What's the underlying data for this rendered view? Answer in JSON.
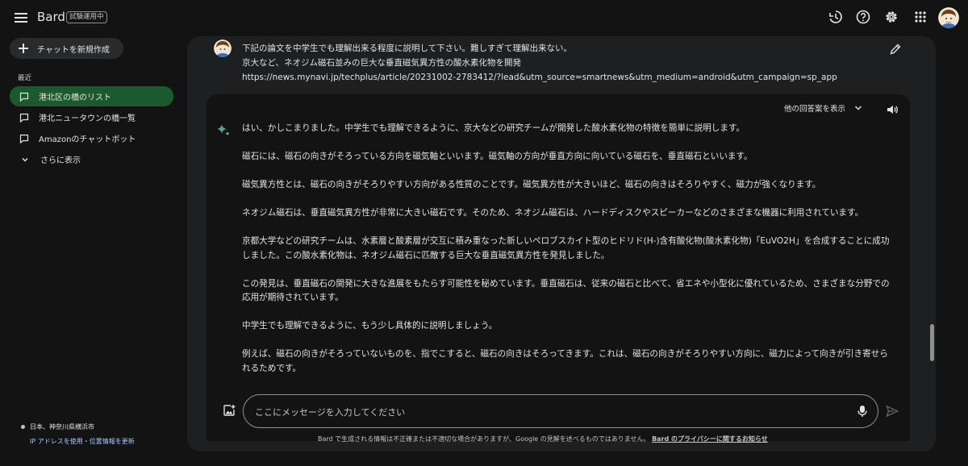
{
  "header": {
    "brand": "Bard",
    "badge": "試験運用中",
    "icons": [
      "menu-icon",
      "history-icon",
      "help-icon",
      "settings-icon",
      "apps-icon",
      "account-avatar"
    ]
  },
  "sidebar": {
    "new_chat_label": "チャットを新規作成",
    "recent_label": "最近",
    "items": [
      {
        "label": "港北区の橋のリスト",
        "active": true
      },
      {
        "label": "港北ニュータウンの橋一覧",
        "active": false
      },
      {
        "label": "Amazonのチャットボット",
        "active": false
      }
    ],
    "more_label": "さらに表示",
    "location": "日本、神奈川県横浜市",
    "location_link": "IP アドレスを使用・位置情報を更新"
  },
  "prompt": {
    "lines": [
      "下記の論文を中学生でも理解出来る程度に説明して下さい。難しすぎて理解出来ない。",
      "京大など、ネオジム磁石並みの巨大な垂直磁気異方性の酸水素化物を開発",
      "https://news.mynavi.jp/techplus/article/20231002-2783412/?lead&utm_source=smartnews&utm_medium=android&utm_campaign=sp_app"
    ]
  },
  "answer": {
    "alt_drafts_label": "他の回答案を表示",
    "paragraphs": [
      "はい、かしこまりました。中学生でも理解できるように、京大などの研究チームが開発した酸水素化物の特徴を簡単に説明します。",
      "磁石には、磁石の向きがそろっている方向を磁気軸といいます。磁気軸の方向が垂直方向に向いている磁石を、垂直磁石といいます。",
      "磁気異方性とは、磁石の向きがそろりやすい方向がある性質のことです。磁気異方性が大きいほど、磁石の向きはそろりやすく、磁力が強くなります。",
      "ネオジム磁石は、垂直磁気異方性が非常に大きい磁石です。そのため、ネオジム磁石は、ハードディスクやスピーカーなどのさまざまな機器に利用されています。",
      "京都大学などの研究チームは、水素層と酸素層が交互に積み重なった新しいペロブスカイト型のヒドリド(H-)含有酸化物(酸水素化物)「EuVO2H」を合成することに成功しました。この酸水素化物は、ネオジム磁石に匹敵する巨大な垂直磁気異方性を発見しました。",
      "この発見は、垂直磁石の開発に大きな進展をもたらす可能性を秘めています。垂直磁石は、従来の磁石と比べて、省エネや小型化に優れているため、さまざまな分野での応用が期待されています。",
      "中学生でも理解できるように、もう少し具体的に説明しましょう。",
      "例えば、磁石の向きがそろっていないものを、指でこすると、磁石の向きはそろってきます。これは、磁石の向きがそろりやすい方向に、磁力によって向きが引き寄せられるためです。"
    ]
  },
  "input": {
    "placeholder": "ここにメッセージを入力してください"
  },
  "footer": {
    "text": "Bard で生成される情報は不正確または不適切な場合がありますが、Google の見解を述べるものではありません。",
    "link": "Bard のプライバシーに関するお知らせ"
  },
  "colors": {
    "background": "#131314",
    "panel": "#1e1f20",
    "active_item": "#1b5a2f",
    "link": "#a8c7fa"
  }
}
